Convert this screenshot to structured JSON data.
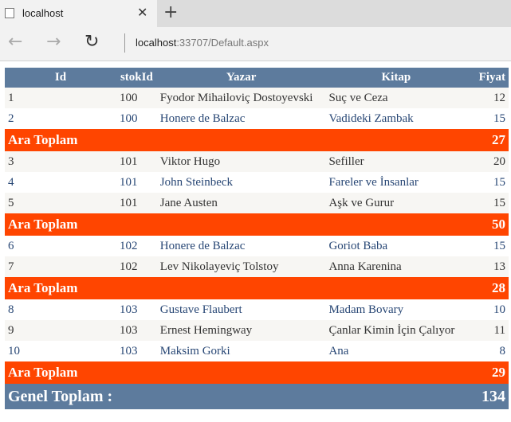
{
  "browser": {
    "tab_title": "localhost",
    "close_glyph": "✕",
    "newtab_glyph": "+",
    "back_glyph": "←",
    "forward_glyph": "→",
    "refresh_glyph": "↻",
    "url_host": "localhost",
    "url_rest": ":33707/Default.aspx"
  },
  "table": {
    "headers": [
      "Id",
      "stokId",
      "Yazar",
      "Kitap",
      "Fiyat"
    ],
    "rows": [
      {
        "id": "1",
        "stokId": "100",
        "yazar": "Fyodor Mihailoviç Dostoyevski",
        "kitap": "Suç ve Ceza",
        "fiyat": "12"
      },
      {
        "id": "2",
        "stokId": "100",
        "yazar": "Honere de Balzac",
        "kitap": "Vadideki Zambak",
        "fiyat": "15"
      },
      {
        "subtotal_label": "Ara Toplam",
        "subtotal_value": "27"
      },
      {
        "id": "3",
        "stokId": "101",
        "yazar": "Viktor Hugo",
        "kitap": "Sefiller",
        "fiyat": "20"
      },
      {
        "id": "4",
        "stokId": "101",
        "yazar": "John Steinbeck",
        "kitap": "Fareler ve İnsanlar",
        "fiyat": "15"
      },
      {
        "id": "5",
        "stokId": "101",
        "yazar": "Jane Austen",
        "kitap": "Aşk ve Gurur",
        "fiyat": "15"
      },
      {
        "subtotal_label": "Ara Toplam",
        "subtotal_value": "50"
      },
      {
        "id": "6",
        "stokId": "102",
        "yazar": "Honere de Balzac",
        "kitap": "Goriot Baba",
        "fiyat": "15"
      },
      {
        "id": "7",
        "stokId": "102",
        "yazar": "Lev Nikolayeviç Tolstoy",
        "kitap": "Anna Karenina",
        "fiyat": "13"
      },
      {
        "subtotal_label": "Ara Toplam",
        "subtotal_value": "28"
      },
      {
        "id": "8",
        "stokId": "103",
        "yazar": "Gustave Flaubert",
        "kitap": "Madam Bovary",
        "fiyat": "10"
      },
      {
        "id": "9",
        "stokId": "103",
        "yazar": "Ernest Hemingway",
        "kitap": "Çanlar Kimin İçin Çalıyor",
        "fiyat": "11"
      },
      {
        "id": "10",
        "stokId": "103",
        "yazar": "Maksim Gorki",
        "kitap": "Ana",
        "fiyat": "8"
      },
      {
        "subtotal_label": "Ara Toplam",
        "subtotal_value": "29"
      }
    ],
    "grand_total_label": "Genel Toplam :",
    "grand_total_value": "134"
  },
  "colors": {
    "header_bg": "#5d7b9d",
    "subtotal_bg": "#ff4500",
    "row_alt_bg": "#f7f6f3",
    "row_text": "#333333",
    "row_alt_text": "#284775"
  },
  "icons": {
    "favicon": "page-icon",
    "close": "close-icon",
    "newtab": "plus-icon",
    "back": "back-arrow-icon",
    "forward": "forward-arrow-icon",
    "refresh": "refresh-icon"
  }
}
